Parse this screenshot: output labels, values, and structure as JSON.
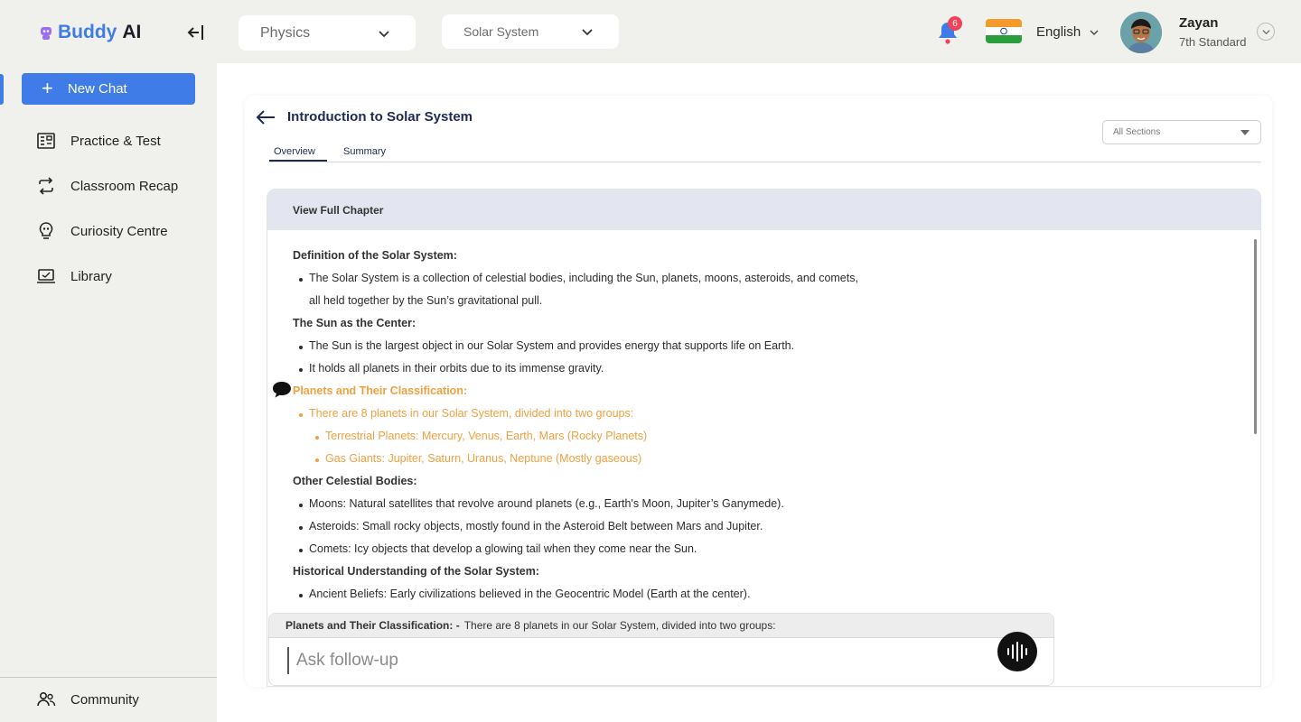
{
  "brand": {
    "name_part1": "Buddy",
    "name_part2": "AI",
    "color_primary": "#3f7ce8"
  },
  "sidebar": {
    "new_chat": "New Chat",
    "items": [
      {
        "label": "Practice & Test",
        "icon": "practice-icon"
      },
      {
        "label": "Classroom Recap",
        "icon": "repeat-icon"
      },
      {
        "label": "Curiosity Centre",
        "icon": "lightbulb-icon"
      },
      {
        "label": "Library",
        "icon": "laptop-icon"
      }
    ],
    "community": "Community"
  },
  "topbar": {
    "subject": "Physics",
    "topic": "Solar System",
    "notification_count": "6",
    "language": "English",
    "user_name": "Zayan",
    "user_grade": "7th Standard"
  },
  "page": {
    "title": "Introduction to Solar System",
    "tabs": [
      "Overview",
      "Summary"
    ],
    "active_tab": "Overview",
    "sections_filter": "All Sections",
    "chapter_header": "View Full Chapter"
  },
  "content": {
    "h1": "Definition of the Solar System:",
    "p1a": "The Solar System is a collection of celestial bodies, including the Sun, planets, moons, asteroids, and comets,",
    "p1b": "all held together by the Sun’s gravitational pull.",
    "h2": "The Sun as the Center:",
    "p2a": "The Sun is the largest object in our Solar System and provides energy that supports life on Earth.",
    "p2b": "It holds all planets in their orbits due to its immense gravity.",
    "h3": "Planets and Their Classification:",
    "p3a": "There are 8 planets in our Solar System, divided into two groups:",
    "p3b": "Terrestrial Planets: Mercury, Venus, Earth, Mars (Rocky Planets)",
    "p3c": "Gas Giants: Jupiter, Saturn, Uranus, Neptune (Mostly gaseous)",
    "h4": "Other Celestial Bodies:",
    "p4a": "Moons: Natural satellites that revolve around planets (e.g., Earth's Moon, Jupiter’s Ganymede).",
    "p4b": "Asteroids: Small rocky objects, mostly found in the Asteroid Belt between Mars and Jupiter.",
    "p4c": "Comets: Icy objects that develop a glowing tail when they come near the Sun.",
    "h5": "Historical Understanding of the Solar System:",
    "p5a": "Ancient Beliefs: Early civilizations believed in the Geocentric Model (Earth at the center).",
    "highlight_color": "#f0a040"
  },
  "followup": {
    "context_label": "Planets and Their Classification: -",
    "context_text": "There are 8 planets in our Solar System, divided into two groups:",
    "placeholder": "Ask follow-up"
  }
}
